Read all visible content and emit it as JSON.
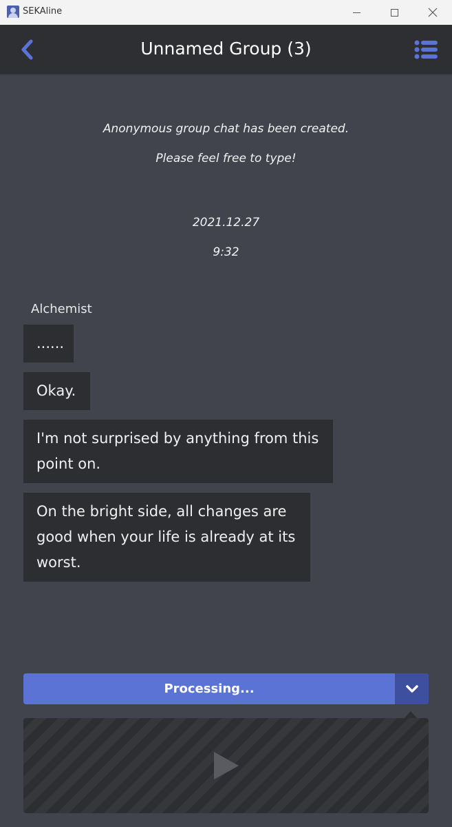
{
  "window": {
    "title": "SEKAline"
  },
  "header": {
    "title": "Unnamed Group (3)",
    "back_icon": "chevron-left-icon",
    "menu_icon": "list-icon",
    "accent_color": "#5b73d4"
  },
  "system_messages": {
    "created": "Anonymous group chat has been created.",
    "prompt": "Please feel free to type!",
    "date": "2021.12.27",
    "time": "9:32"
  },
  "conversation": {
    "sender": "Alchemist",
    "messages": [
      {
        "text": "......"
      },
      {
        "text": "Okay."
      },
      {
        "text": "I'm not surprised by anything from this point on."
      },
      {
        "text": "On the bright side, all changes are good when your life is already at its worst."
      }
    ]
  },
  "controls": {
    "status_label": "Processing...",
    "dropdown_icon": "chevron-down-icon",
    "play_icon": "play-icon"
  }
}
